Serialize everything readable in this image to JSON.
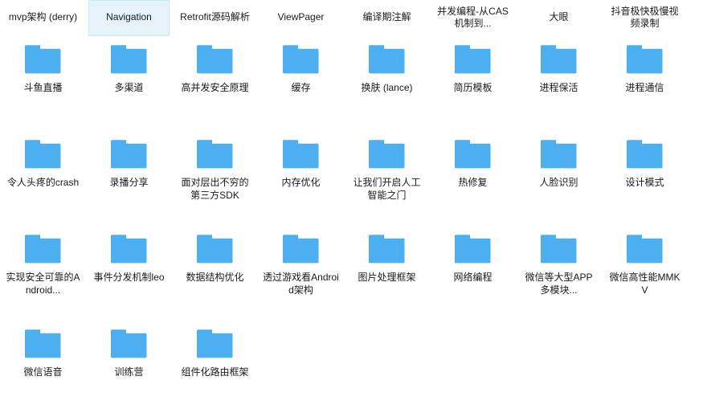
{
  "view": {
    "type": "file-explorer-grid",
    "columns": 8,
    "background_color": "#ffffff",
    "folder_icon_color": "#4dafef",
    "selection_background": "#e5f3fb",
    "selection_border": "#cce8f5",
    "label_color": "#1a1a1a",
    "icon_name": "folder-icon",
    "scrolled": true
  },
  "rows": [
    {
      "icons_visible": false,
      "items": [
        {
          "label": "mvp架构\n(derry)",
          "selected": false
        },
        {
          "label": "Navigation",
          "selected": true
        },
        {
          "label": "Retrofit源码解析",
          "selected": false
        },
        {
          "label": "ViewPager",
          "selected": false
        },
        {
          "label": "编译期注解",
          "selected": false
        },
        {
          "label": "并发编程-从CAS机制到...",
          "selected": false
        },
        {
          "label": "大眼",
          "selected": false
        },
        {
          "label": "抖音极快极慢视频录制",
          "selected": false
        }
      ]
    },
    {
      "icons_visible": true,
      "items": [
        {
          "label": "斗鱼直播",
          "selected": false
        },
        {
          "label": "多渠道",
          "selected": false
        },
        {
          "label": "高并发安全原理",
          "selected": false
        },
        {
          "label": "缓存",
          "selected": false
        },
        {
          "label": "换肤\n(lance)",
          "selected": false
        },
        {
          "label": "简历模板",
          "selected": false
        },
        {
          "label": "进程保活",
          "selected": false
        },
        {
          "label": "进程通信",
          "selected": false
        }
      ]
    },
    {
      "icons_visible": true,
      "items": [
        {
          "label": "令人头疼的crash",
          "selected": false
        },
        {
          "label": "录播分享",
          "selected": false
        },
        {
          "label": "面对层出不穷的第三方SDK",
          "selected": false
        },
        {
          "label": "内存优化",
          "selected": false
        },
        {
          "label": "让我们开启人工智能之门",
          "selected": false
        },
        {
          "label": "热修复",
          "selected": false
        },
        {
          "label": "人脸识别",
          "selected": false
        },
        {
          "label": "设计模式",
          "selected": false
        }
      ]
    },
    {
      "icons_visible": true,
      "items": [
        {
          "label": "实现安全可靠的Android...",
          "selected": false
        },
        {
          "label": "事件分发机制leo",
          "selected": false
        },
        {
          "label": "数据结构优化",
          "selected": false
        },
        {
          "label": "透过游戏看Android架构",
          "selected": false
        },
        {
          "label": "图片处理框架",
          "selected": false
        },
        {
          "label": "网络编程",
          "selected": false
        },
        {
          "label": "微信等大型APP多模块...",
          "selected": false
        },
        {
          "label": "微信高性能MMKV",
          "selected": false
        }
      ]
    },
    {
      "icons_visible": true,
      "items": [
        {
          "label": "微信语音",
          "selected": false
        },
        {
          "label": "训练营",
          "selected": false
        },
        {
          "label": "组件化路由框架",
          "selected": false
        }
      ]
    }
  ]
}
